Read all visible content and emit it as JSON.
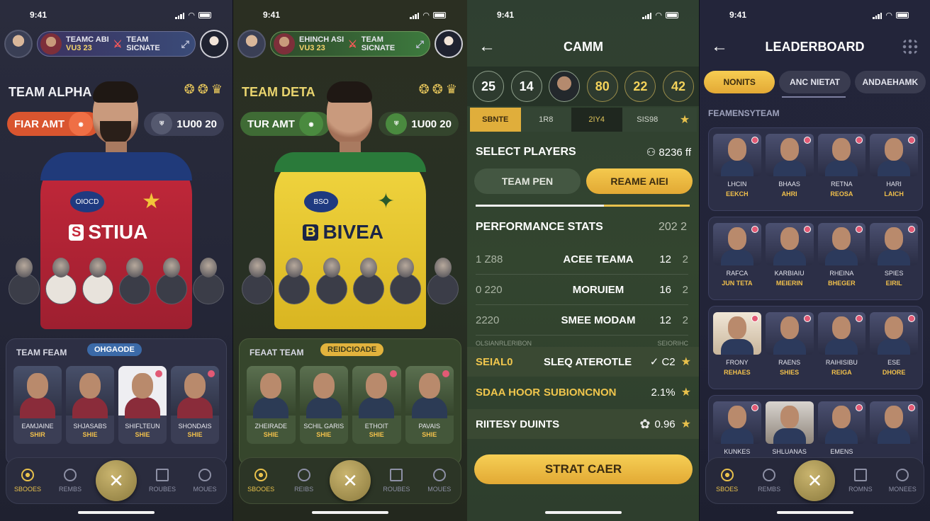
{
  "status": {
    "time": "9:41"
  },
  "screen1": {
    "matchup": {
      "line1": "TEAMC ABI",
      "line2": "VU3 23",
      "team_line1": "TEAM",
      "team_line2": "SICNATE"
    },
    "hero": {
      "team_name": "TEAM ALPHA",
      "pill_left": "FIAR AMT",
      "pill_right": "1U00 20",
      "jersey_sponsor": "STIUA",
      "jersey_crest": "OIOCD"
    },
    "panel": {
      "title": "TEAM FEAM",
      "chip": "OHGAODE",
      "cards": [
        {
          "name": "EAMJAINE",
          "role": "SHIR"
        },
        {
          "name": "SHJASABS",
          "role": "SHIE"
        },
        {
          "name": "SHIFLTEUN",
          "role": "SHIE"
        },
        {
          "name": "SHONDAIS",
          "role": "SHIE"
        }
      ]
    },
    "nav": [
      {
        "label": "SBOOES",
        "icon": "trophy-icon"
      },
      {
        "label": "REMBS",
        "icon": "camera-icon"
      },
      {
        "label": "",
        "icon": "cricket-bats-icon"
      },
      {
        "label": "ROUBES",
        "icon": "book-icon"
      },
      {
        "label": "MOUES",
        "icon": "user-icon"
      }
    ]
  },
  "screen2": {
    "matchup": {
      "line1": "EHINCH ASI",
      "line2": "VU3 23",
      "team_line1": "TEAM",
      "team_line2": "SICNATE"
    },
    "hero": {
      "team_name": "TEAM DETA",
      "pill_left": "TUR AMT",
      "pill_right": "1U00 20",
      "jersey_sponsor": "BIVEA",
      "jersey_crest": "BSO"
    },
    "panel": {
      "title": "FEAAT TEAM",
      "chip": "REIDCIOADE",
      "cards": [
        {
          "name": "ZHEIRADE",
          "role": "SHIE"
        },
        {
          "name": "SCHIL GARIS",
          "role": "SHIE"
        },
        {
          "name": "ETHOIT",
          "role": "SHIE"
        },
        {
          "name": "PAVAIS",
          "role": "SHIE"
        }
      ]
    },
    "nav": [
      {
        "label": "SBOOES",
        "icon": "trophy-icon"
      },
      {
        "label": "REIBS",
        "icon": "camera-icon"
      },
      {
        "label": "",
        "icon": "cricket-bats-icon"
      },
      {
        "label": "ROUBES",
        "icon": "book-icon"
      },
      {
        "label": "MOUES",
        "icon": "user-icon"
      }
    ]
  },
  "screen3": {
    "title": "CAMM",
    "circles": [
      "25",
      "14",
      "",
      "80",
      "22",
      "42"
    ],
    "tabs": [
      "SBNTE",
      "1R8",
      "2IY4",
      "SIS98"
    ],
    "select_label": "SELECT PLAYERS",
    "select_value": "8236 ff",
    "btn_left": "TEAM PEN",
    "btn_right": "REAME AIEI",
    "perf_title": "PERFORMANCE STATS",
    "perf_value": "202 2",
    "rows": [
      {
        "a": "1 Z88",
        "b": "ACEE TEAMA",
        "c": "12",
        "d": "2"
      },
      {
        "a": "0 220",
        "b": "MORUIEM",
        "c": "16",
        "d": "2"
      },
      {
        "a": "2220",
        "b": "SMEE MODAM",
        "c": "12",
        "d": "2"
      }
    ],
    "caption_left": "OLSIANRLERIBON",
    "caption_right": "SEIORIHC",
    "highlights": [
      {
        "a": "SEIAL0",
        "b": "SLEQ ATEROTLE",
        "c": "✓ C2"
      },
      {
        "a": "SDAA HOOR",
        "b": "SUBIONCNON",
        "c": "2.1%"
      },
      {
        "a": "",
        "b": "RIITESY DUINTS",
        "c": "0.96"
      }
    ],
    "cta": "STRAT CAER"
  },
  "screen4": {
    "title": "LEADERBOARD",
    "segments": [
      "NONITS",
      "ANC NIETAT",
      "ANDAEHAMK"
    ],
    "caption": "FEAMENSYTEAM",
    "rows": [
      [
        {
          "n1": "LHCIN",
          "n2": "EEKCH"
        },
        {
          "n1": "BHAAS",
          "n2": "AHRI"
        },
        {
          "n1": "RETNA",
          "n2": "REOSA"
        },
        {
          "n1": "HARI",
          "n2": "LAICH"
        }
      ],
      [
        {
          "n1": "RAFCA",
          "n2": "JUN TETA"
        },
        {
          "n1": "KARBIAIU",
          "n2": "MEIERIN"
        },
        {
          "n1": "RHEINA",
          "n2": "BHEGER"
        },
        {
          "n1": "SPIES",
          "n2": "EIRIL"
        }
      ],
      [
        {
          "n1": "FRONY",
          "n2": "REHAES"
        },
        {
          "n1": "RAENS",
          "n2": "SHIES"
        },
        {
          "n1": "RAIHISIBU",
          "n2": "REIGA"
        },
        {
          "n1": "ESE",
          "n2": "DHORE"
        }
      ],
      [
        {
          "n1": "KUNKES",
          "n2": ""
        },
        {
          "n1": "SHLUANAS",
          "n2": ""
        },
        {
          "n1": "EMENS",
          "n2": ""
        },
        {
          "n1": "",
          "n2": ""
        }
      ]
    ],
    "nav": [
      {
        "label": "SBOES",
        "icon": "trophy-icon"
      },
      {
        "label": "REMBS",
        "icon": "camera-icon"
      },
      {
        "label": "",
        "icon": "cricket-bats-icon"
      },
      {
        "label": "ROMNS",
        "icon": "book-icon"
      },
      {
        "label": "MONEES",
        "icon": "user-icon"
      }
    ]
  },
  "colors": {
    "accent": "#e8c14c",
    "orange": "#d9552f",
    "green": "#3f6b35"
  }
}
